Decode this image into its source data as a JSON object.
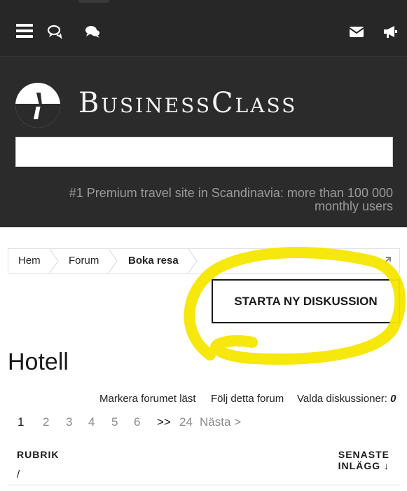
{
  "topbar": {
    "icons": [
      "menu-icon",
      "conversations-icon",
      "chat-bubbles-icon",
      "mail-icon",
      "megaphone-icon"
    ]
  },
  "header": {
    "logo_text": "BusinessClass",
    "tagline": "#1 Premium travel site in Scandinavia: more than 100 000 monthly users",
    "search_value": ""
  },
  "breadcrumb": {
    "items": [
      "Hem",
      "Forum",
      "Boka resa"
    ]
  },
  "new_discussion_label": "STARTA NY DISKUSSION",
  "forum_title": "Hotell",
  "actions": {
    "mark_read": "Markera forumet läst",
    "follow": "Följ detta forum",
    "selected_label": "Valda diskussioner:",
    "selected_count": "0"
  },
  "pagination": {
    "current": "1",
    "pages": [
      "2",
      "3",
      "4",
      "5",
      "6"
    ],
    "skip": ">>",
    "last": "24",
    "next": "Nästa >"
  },
  "columns": {
    "title": "RUBRIK",
    "latest_line1": "SENASTE",
    "latest_line2": "INLÄGG ↓",
    "row_placeholder": "/"
  },
  "colors": {
    "header_bg": "#2b2b2b",
    "highlight": "#f5e600"
  }
}
